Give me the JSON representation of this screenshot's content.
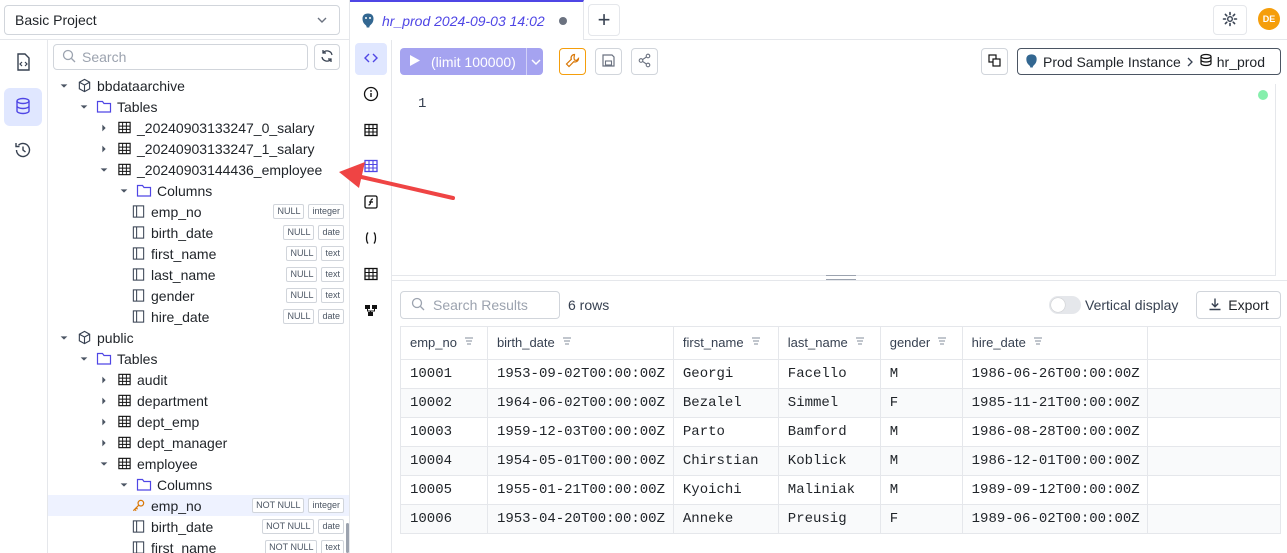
{
  "project": {
    "name": "Basic Project"
  },
  "tree": {
    "search_placeholder": "Search",
    "rows": [
      {
        "label": "bbdataarchive",
        "level": 0,
        "kind": "db",
        "caret": "down"
      },
      {
        "label": "Tables",
        "level": 1,
        "kind": "folder",
        "caret": "down"
      },
      {
        "label": "_20240903133247_0_salary",
        "level": 2,
        "kind": "table",
        "caret": "right"
      },
      {
        "label": "_20240903133247_1_salary",
        "level": 2,
        "kind": "table",
        "caret": "right"
      },
      {
        "label": "_20240903144436_employee",
        "level": 2,
        "kind": "table",
        "caret": "down"
      },
      {
        "label": "Columns",
        "level": 3,
        "kind": "folder",
        "caret": "down"
      },
      {
        "label": "emp_no",
        "level": 4,
        "kind": "column",
        "caret": "none",
        "badges": [
          "NULL",
          "integer"
        ]
      },
      {
        "label": "birth_date",
        "level": 4,
        "kind": "column",
        "caret": "none",
        "badges": [
          "NULL",
          "date"
        ]
      },
      {
        "label": "first_name",
        "level": 4,
        "kind": "column",
        "caret": "none",
        "badges": [
          "NULL",
          "text"
        ]
      },
      {
        "label": "last_name",
        "level": 4,
        "kind": "column",
        "caret": "none",
        "badges": [
          "NULL",
          "text"
        ]
      },
      {
        "label": "gender",
        "level": 4,
        "kind": "column",
        "caret": "none",
        "badges": [
          "NULL",
          "text"
        ]
      },
      {
        "label": "hire_date",
        "level": 4,
        "kind": "column",
        "caret": "none",
        "badges": [
          "NULL",
          "date"
        ]
      },
      {
        "label": "public",
        "level": 0,
        "kind": "db",
        "caret": "down"
      },
      {
        "label": "Tables",
        "level": 1,
        "kind": "folder",
        "caret": "down"
      },
      {
        "label": "audit",
        "level": 2,
        "kind": "table",
        "caret": "right"
      },
      {
        "label": "department",
        "level": 2,
        "kind": "table",
        "caret": "right"
      },
      {
        "label": "dept_emp",
        "level": 2,
        "kind": "table",
        "caret": "right"
      },
      {
        "label": "dept_manager",
        "level": 2,
        "kind": "table",
        "caret": "right"
      },
      {
        "label": "employee",
        "level": 2,
        "kind": "table",
        "caret": "down"
      },
      {
        "label": "Columns",
        "level": 3,
        "kind": "folder",
        "caret": "down"
      },
      {
        "label": "emp_no",
        "level": 4,
        "kind": "key",
        "caret": "none",
        "badges": [
          "NOT NULL",
          "integer"
        ],
        "selected": true
      },
      {
        "label": "birth_date",
        "level": 4,
        "kind": "column",
        "caret": "none",
        "badges": [
          "NOT NULL",
          "date"
        ]
      },
      {
        "label": "first_name",
        "level": 4,
        "kind": "column",
        "caret": "none",
        "badges": [
          "NOT NULL",
          "text"
        ]
      }
    ]
  },
  "tab": {
    "title": "hr_prod 2024-09-03 14:02",
    "add_label": "+"
  },
  "user": {
    "initials": "DE"
  },
  "editor": {
    "run_label": "(limit 100000)",
    "instance": "Prod Sample Instance",
    "separator": ">",
    "database": "hr_prod",
    "line_number": "1"
  },
  "results": {
    "search_placeholder": "Search Results",
    "row_count": "6 rows",
    "vertical_label": "Vertical display",
    "export_label": "Export",
    "columns": [
      "emp_no",
      "birth_date",
      "first_name",
      "last_name",
      "gender",
      "hire_date"
    ],
    "rows": [
      [
        "10001",
        "1953-09-02T00:00:00Z",
        "Georgi",
        "Facello",
        "M",
        "1986-06-26T00:00:00Z"
      ],
      [
        "10002",
        "1964-06-02T00:00:00Z",
        "Bezalel",
        "Simmel",
        "F",
        "1985-11-21T00:00:00Z"
      ],
      [
        "10003",
        "1959-12-03T00:00:00Z",
        "Parto",
        "Bamford",
        "M",
        "1986-08-28T00:00:00Z"
      ],
      [
        "10004",
        "1954-05-01T00:00:00Z",
        "Chirstian",
        "Koblick",
        "M",
        "1986-12-01T00:00:00Z"
      ],
      [
        "10005",
        "1955-01-21T00:00:00Z",
        "Kyoichi",
        "Maliniak",
        "M",
        "1989-09-12T00:00:00Z"
      ],
      [
        "10006",
        "1953-04-20T00:00:00Z",
        "Anneke",
        "Preusig",
        "F",
        "1989-06-02T00:00:00Z"
      ]
    ]
  },
  "colors": {
    "accent": "#4f46e5",
    "run_button": "#a5a3f0",
    "annotation": "#ef4444",
    "avatar": "#f59e0b"
  }
}
